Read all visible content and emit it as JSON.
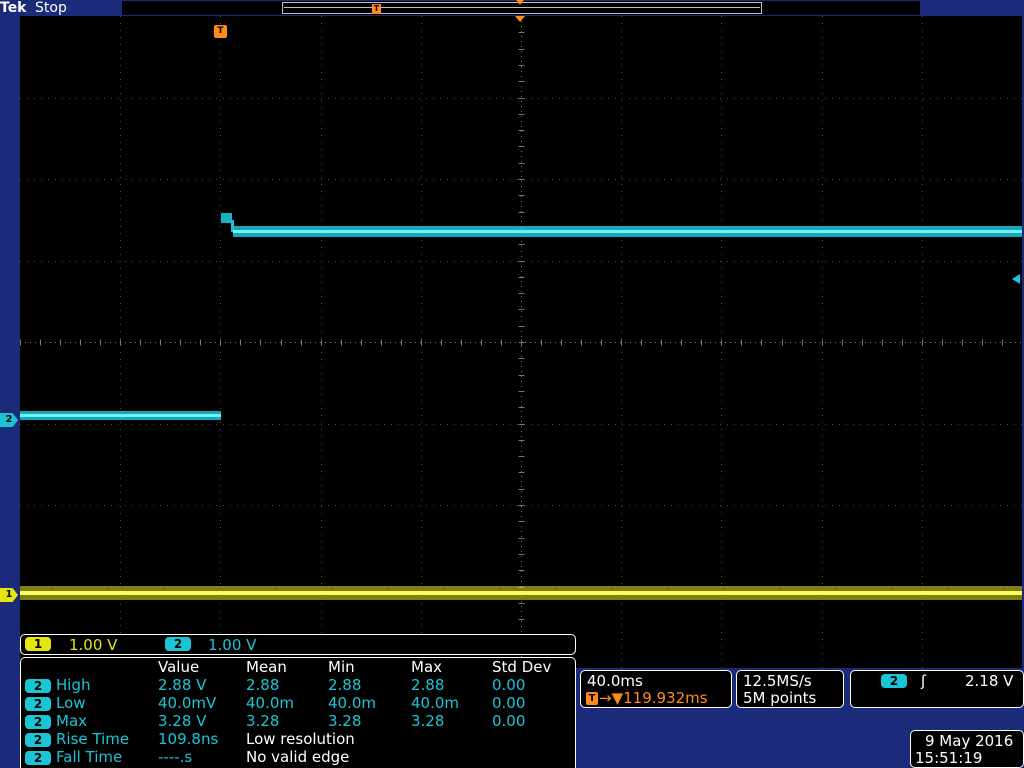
{
  "top_bar": {
    "brand": "Tek",
    "status": "Stop",
    "trigger_marker_glyph": "T"
  },
  "markers": {
    "ch2": "2",
    "ch1": "1",
    "trigger_position": "T"
  },
  "traces": [
    {
      "name": "channel-2",
      "color": "#1ac6d6"
    },
    {
      "name": "channel-1",
      "color": "#e6e60f"
    }
  ],
  "channel_scales": [
    {
      "channel": "1",
      "scale": "1.00 V",
      "color": "#e6e60f"
    },
    {
      "channel": "2",
      "scale": "1.00 V",
      "color": "#1ac6d6"
    }
  ],
  "measurements": {
    "headers": [
      "Value",
      "Mean",
      "Min",
      "Max",
      "Std Dev"
    ],
    "rows": [
      {
        "channel": "2",
        "name": "High",
        "value": "2.88 V",
        "mean": "2.88",
        "min": "2.88",
        "max": "2.88",
        "std": "0.00"
      },
      {
        "channel": "2",
        "name": "Low",
        "value": "40.0mV",
        "mean": "40.0m",
        "min": "40.0m",
        "max": "40.0m",
        "std": "0.00"
      },
      {
        "channel": "2",
        "name": "Max",
        "value": "3.28 V",
        "mean": "3.28",
        "min": "3.28",
        "max": "3.28",
        "std": "0.00"
      },
      {
        "channel": "2",
        "name": "Rise Time",
        "value": "109.8ns",
        "note": "Low resolution"
      },
      {
        "channel": "2",
        "name": "Fall Time",
        "value": "----.s",
        "note": "No valid edge"
      }
    ]
  },
  "horizontal": {
    "scale": "40.0ms",
    "trigger_glyph": "T",
    "delay": "→▼119.932ms"
  },
  "acquisition": {
    "sample_rate": "12.5MS/s",
    "record_length": "5M points"
  },
  "trigger": {
    "source": "2",
    "slope_glyph": "ʃ",
    "level": "2.18 V"
  },
  "datetime": {
    "date": "9 May 2016",
    "time": "15:51:19"
  },
  "colors": {
    "ch1": "#e6e60f",
    "ch2": "#1ac6d6",
    "trigger": "#ff8c1a",
    "frame": "#1c2a7a",
    "screen": "#000000"
  }
}
